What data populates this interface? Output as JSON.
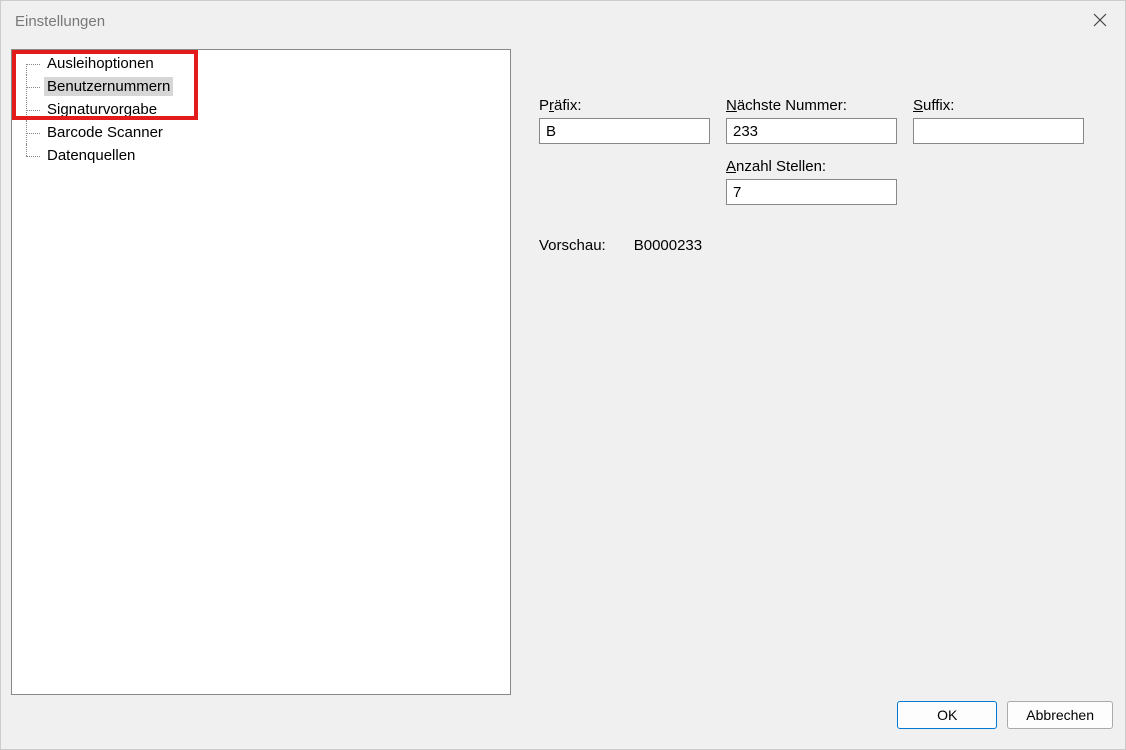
{
  "window": {
    "title": "Einstellungen"
  },
  "tree": {
    "items": [
      {
        "label": "Ausleihoptionen",
        "selected": false
      },
      {
        "label": "Benutzernummern",
        "selected": true
      },
      {
        "label": "Signaturvorgabe",
        "selected": false
      },
      {
        "label": "Barcode Scanner",
        "selected": false
      },
      {
        "label": "Datenquellen",
        "selected": false
      }
    ]
  },
  "form": {
    "prefix_label_pre": "P",
    "prefix_label_u": "r",
    "prefix_label_post": "äfix:",
    "prefix_value": "B",
    "next_label_u": "N",
    "next_label_post": "ächste Nummer:",
    "next_value": "233",
    "suffix_label_u": "S",
    "suffix_label_post": "uffix:",
    "suffix_value": "",
    "digits_label_u": "A",
    "digits_label_post": "nzahl Stellen:",
    "digits_value": "7",
    "preview_label": "Vorschau:",
    "preview_value": "B0000233"
  },
  "buttons": {
    "ok": "OK",
    "cancel": "Abbrechen"
  }
}
